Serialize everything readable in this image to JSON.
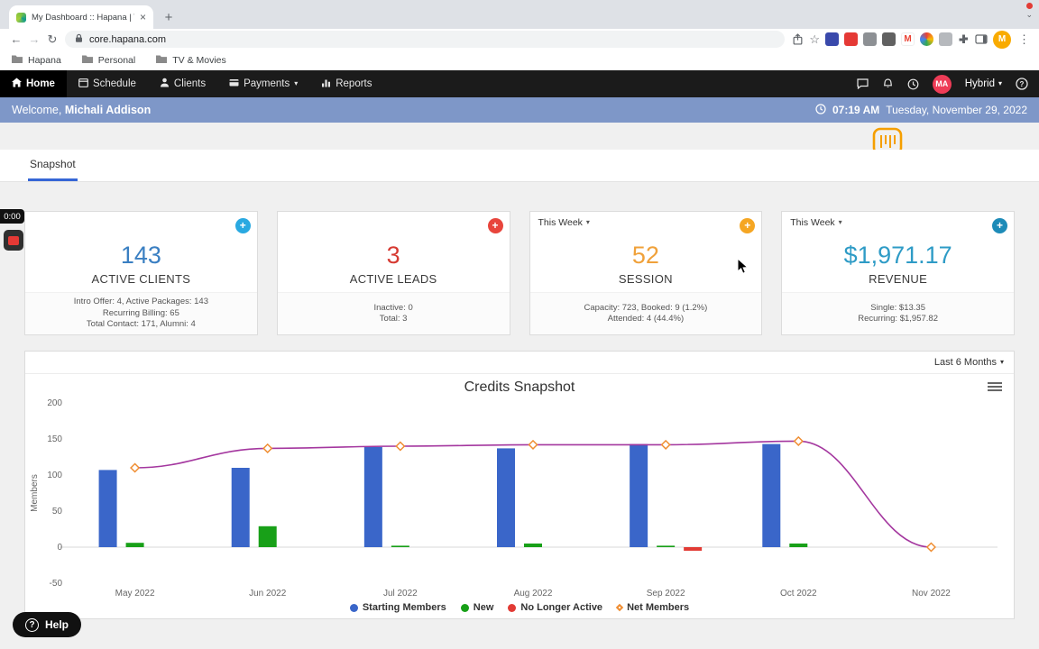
{
  "browser": {
    "tab": {
      "title": "My Dashboard :: Hapana | Tak"
    },
    "url": "core.hapana.com",
    "profile_initial": "M",
    "gmail_initial": "M",
    "bookmarks": [
      {
        "label": "Hapana"
      },
      {
        "label": "Personal"
      },
      {
        "label": "TV & Movies"
      }
    ]
  },
  "nav": {
    "items": [
      {
        "label": "Home"
      },
      {
        "label": "Schedule"
      },
      {
        "label": "Clients"
      },
      {
        "label": "Payments"
      },
      {
        "label": "Reports"
      }
    ],
    "avatar_initials": "MA",
    "mode_label": "Hybrid"
  },
  "welcome": {
    "greeting": "Welcome,",
    "name": "Michali Addison",
    "time": "07:19 AM",
    "date": "Tuesday, November 29, 2022"
  },
  "snapshot_tab_label": "Snapshot",
  "promo_badge": "1",
  "recorder_time": "0:00",
  "cards": [
    {
      "value": "143",
      "label": "ACTIVE CLIENTS",
      "color": "#3a7fc2",
      "plus_color": "#29a9e1",
      "footer": [
        "Intro Offer: 4, Active Packages: 143",
        "Recurring Billing: 65",
        "Total Contact: 171, Alumni: 4"
      ]
    },
    {
      "value": "3",
      "label": "ACTIVE LEADS",
      "color": "#d63a32",
      "plus_color": "#e8453c",
      "footer": [
        "Inactive: 0",
        "Total: 3"
      ]
    },
    {
      "dropdown": "This Week",
      "value": "52",
      "label": "SESSION",
      "color": "#f0a13a",
      "plus_color": "#f5a623",
      "footer": [
        "Capacity: 723, Booked: 9 (1.2%)",
        "Attended: 4 (44.4%)"
      ]
    },
    {
      "dropdown": "This Week",
      "value": "$1,971.17",
      "label": "REVENUE",
      "color": "#2e9bc6",
      "plus_color": "#1d8bb8",
      "footer": [
        "Single: $13.35",
        "Recurring: $1,957.82"
      ]
    }
  ],
  "chart_card": {
    "range_label": "Last 6 Months"
  },
  "chart_data": {
    "type": "bar+line",
    "title": "Credits Snapshot",
    "ylabel": "Members",
    "categories": [
      "May 2022",
      "Jun 2022",
      "Jul 2022",
      "Aug 2022",
      "Sep 2022",
      "Oct 2022",
      "Nov 2022"
    ],
    "ylim": [
      -50,
      200
    ],
    "yticks": [
      200,
      150,
      100,
      50,
      0,
      -50
    ],
    "grid": false,
    "legend_position": "bottom",
    "series": [
      {
        "name": "Starting Members",
        "type": "bar",
        "color": "#3a66c9",
        "values": [
          107,
          110,
          139,
          137,
          143,
          143,
          0
        ]
      },
      {
        "name": "New",
        "type": "bar",
        "color": "#18a018",
        "values": [
          6,
          29,
          2,
          5,
          2,
          5,
          0
        ]
      },
      {
        "name": "No Longer Active",
        "type": "bar",
        "color": "#e23b35",
        "values": [
          0,
          0,
          0,
          0,
          -5,
          0,
          0
        ]
      },
      {
        "name": "Net Members",
        "type": "line",
        "color": "#a4379f",
        "marker_color": "#ef8d31",
        "values": [
          110,
          137,
          140,
          142,
          142,
          147,
          0
        ]
      }
    ]
  },
  "help_label": "Help"
}
